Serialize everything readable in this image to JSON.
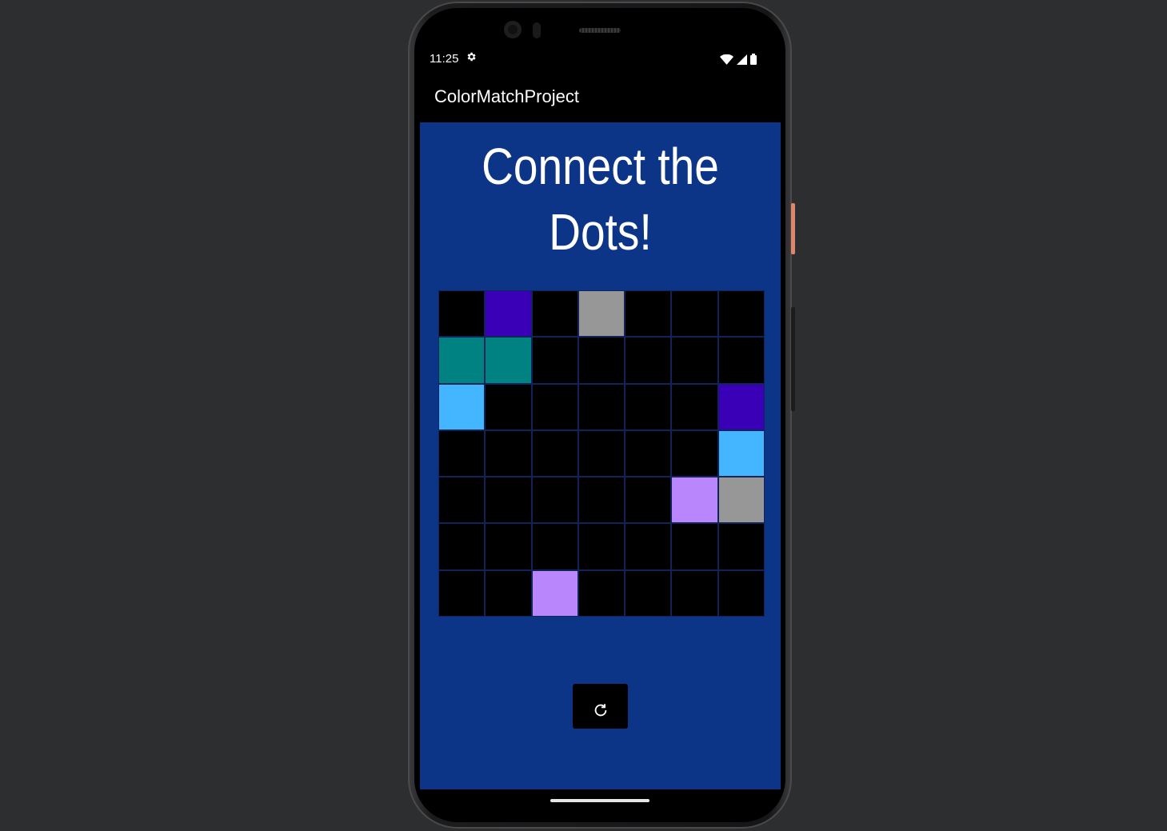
{
  "status_bar": {
    "time": "11:25",
    "icons": [
      "gear-icon",
      "wifi-icon",
      "signal-icon",
      "battery-icon"
    ]
  },
  "app_bar": {
    "title": "ColorMatchProject"
  },
  "main": {
    "headline": "Connect the Dots!",
    "background_color": "#0d3587",
    "grid": {
      "rows": 7,
      "cols": 7,
      "cells": [
        [
          "#000000",
          "#3a00b8",
          "#000000",
          "#979797",
          "#000000",
          "#000000",
          "#000000"
        ],
        [
          "#008282",
          "#008282",
          "#000000",
          "#000000",
          "#000000",
          "#000000",
          "#000000"
        ],
        [
          "#44b5ff",
          "#000000",
          "#000000",
          "#000000",
          "#000000",
          "#000000",
          "#3a00b8"
        ],
        [
          "#000000",
          "#000000",
          "#000000",
          "#000000",
          "#000000",
          "#000000",
          "#44b5ff"
        ],
        [
          "#000000",
          "#000000",
          "#000000",
          "#000000",
          "#000000",
          "#b987fb",
          "#979797"
        ],
        [
          "#000000",
          "#000000",
          "#000000",
          "#000000",
          "#000000",
          "#000000",
          "#000000"
        ],
        [
          "#000000",
          "#000000",
          "#b987fb",
          "#000000",
          "#000000",
          "#000000",
          "#000000"
        ]
      ]
    },
    "reset_button": {
      "icon": "refresh-icon"
    }
  }
}
